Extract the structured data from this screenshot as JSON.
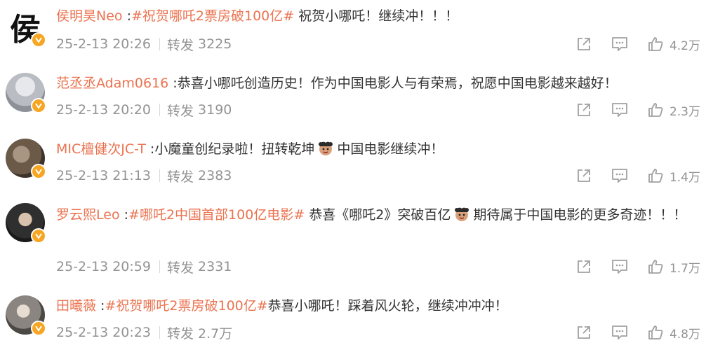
{
  "posts": [
    {
      "username": "侯明昊Neo",
      "sep": " :",
      "topic": "#祝贺哪吒2票房破100亿#",
      "text": " 祝贺小哪吒！继续冲！！！",
      "date": "25-2-13 20:26",
      "repost_label": "转发",
      "repost_count": "3225",
      "likes": "4.2万",
      "avatar_char": "侯",
      "avatar_color": "#ffffff"
    },
    {
      "username": "范丞丞Adam0616",
      "sep": " :",
      "text": "恭喜小哪吒创造历史！作为中国电影人与有荣焉，祝愿中国电影越来越好！",
      "date": "25-2-13 20:20",
      "repost_label": "转发",
      "repost_count": "3190",
      "likes": "2.3万",
      "avatar_color": "#c9ccd1"
    },
    {
      "username": "MIC檀健次JC-T",
      "sep": " :",
      "text_before": "小魔童创纪录啦！扭转乾坤",
      "emoji": "nezha-emoji",
      "text_after": "中国电影继续冲！",
      "date": "25-2-13 21:13",
      "repost_label": "转发",
      "repost_count": "2383",
      "likes": "1.4万",
      "avatar_color": "#6b5a48"
    },
    {
      "username": "罗云熙Leo",
      "sep": " :",
      "topic": "#哪吒2中国首部100亿电影#",
      "text_before": " 恭喜《哪吒2》突破百亿",
      "emoji": "nezha-emoji",
      "text_after": "期待属于中国电影的更多奇迹！！！",
      "date": "25-2-13 20:59",
      "repost_label": "转发",
      "repost_count": "2331",
      "likes": "1.7万",
      "avatar_color": "#2f2f2f"
    },
    {
      "username": "田曦薇",
      "sep": " :",
      "topic": "#祝贺哪吒2票房破100亿#",
      "text": "恭喜小哪吒！踩着风火轮，继续冲冲冲！",
      "date": "25-2-13 20:23",
      "repost_label": "转发",
      "repost_count": "2.7万",
      "likes": "4.8万",
      "avatar_color": "#8a8580"
    }
  ],
  "colors": {
    "accent": "#eb7350",
    "meta": "#939393",
    "badge": "#f6a623"
  },
  "icons": [
    "share-icon",
    "comment-icon",
    "like-icon",
    "verified-badge-icon"
  ]
}
